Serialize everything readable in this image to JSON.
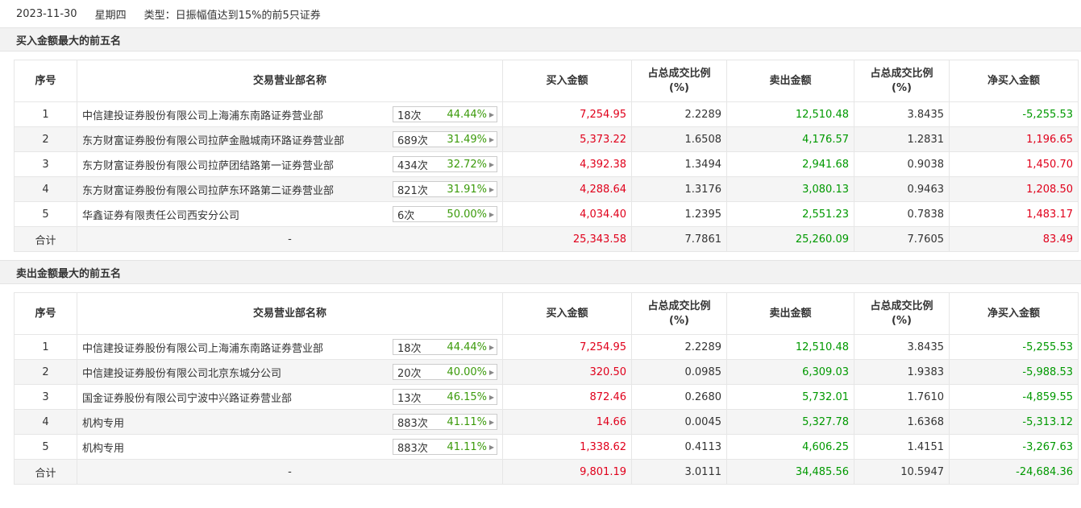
{
  "header": {
    "date": "2023-11-30",
    "weekday": "星期四",
    "type_text": "类型：日振幅值达到15%的前5只证券"
  },
  "columns": {
    "no": "序号",
    "dept": "交易营业部名称",
    "buy": "买入金额",
    "buy_ratio_l1": "占总成交比例",
    "buy_ratio_l2": "(%)",
    "sell": "卖出金额",
    "sell_ratio_l1": "占总成交比例",
    "sell_ratio_l2": "(%)",
    "net": "净买入金额"
  },
  "buy_section": {
    "title": "买入金额最大的前五名",
    "rows": [
      {
        "no": "1",
        "dept": "中信建投证券股份有限公司上海浦东南路证券营业部",
        "count": "18次",
        "pct": "44.44%",
        "buy": "7,254.95",
        "buy_ratio": "2.2289",
        "sell": "12,510.48",
        "sell_ratio": "3.8435",
        "net": "-5,255.53",
        "net_color": "green"
      },
      {
        "no": "2",
        "dept": "东方财富证券股份有限公司拉萨金融城南环路证券营业部",
        "count": "689次",
        "pct": "31.49%",
        "buy": "5,373.22",
        "buy_ratio": "1.6508",
        "sell": "4,176.57",
        "sell_ratio": "1.2831",
        "net": "1,196.65",
        "net_color": "red"
      },
      {
        "no": "3",
        "dept": "东方财富证券股份有限公司拉萨团结路第一证券营业部",
        "count": "434次",
        "pct": "32.72%",
        "buy": "4,392.38",
        "buy_ratio": "1.3494",
        "sell": "2,941.68",
        "sell_ratio": "0.9038",
        "net": "1,450.70",
        "net_color": "red"
      },
      {
        "no": "4",
        "dept": "东方财富证券股份有限公司拉萨东环路第二证券营业部",
        "count": "821次",
        "pct": "31.91%",
        "buy": "4,288.64",
        "buy_ratio": "1.3176",
        "sell": "3,080.13",
        "sell_ratio": "0.9463",
        "net": "1,208.50",
        "net_color": "red"
      },
      {
        "no": "5",
        "dept": "华鑫证券有限责任公司西安分公司",
        "count": "6次",
        "pct": "50.00%",
        "buy": "4,034.40",
        "buy_ratio": "1.2395",
        "sell": "2,551.23",
        "sell_ratio": "0.7838",
        "net": "1,483.17",
        "net_color": "red"
      }
    ],
    "total": {
      "label": "合计",
      "dept": "-",
      "buy": "25,343.58",
      "buy_ratio": "7.7861",
      "sell": "25,260.09",
      "sell_ratio": "7.7605",
      "net": "83.49"
    }
  },
  "sell_section": {
    "title": "卖出金额最大的前五名",
    "rows": [
      {
        "no": "1",
        "dept": "中信建投证券股份有限公司上海浦东南路证券营业部",
        "count": "18次",
        "pct": "44.44%",
        "buy": "7,254.95",
        "buy_ratio": "2.2289",
        "sell": "12,510.48",
        "sell_ratio": "3.8435",
        "net": "-5,255.53",
        "net_color": "green"
      },
      {
        "no": "2",
        "dept": "中信建投证券股份有限公司北京东城分公司",
        "count": "20次",
        "pct": "40.00%",
        "buy": "320.50",
        "buy_ratio": "0.0985",
        "sell": "6,309.03",
        "sell_ratio": "1.9383",
        "net": "-5,988.53",
        "net_color": "green"
      },
      {
        "no": "3",
        "dept": "国金证券股份有限公司宁波中兴路证券营业部",
        "count": "13次",
        "pct": "46.15%",
        "buy": "872.46",
        "buy_ratio": "0.2680",
        "sell": "5,732.01",
        "sell_ratio": "1.7610",
        "net": "-4,859.55",
        "net_color": "green"
      },
      {
        "no": "4",
        "dept": "机构专用",
        "count": "883次",
        "pct": "41.11%",
        "buy": "14.66",
        "buy_ratio": "0.0045",
        "sell": "5,327.78",
        "sell_ratio": "1.6368",
        "net": "-5,313.12",
        "net_color": "green"
      },
      {
        "no": "5",
        "dept": "机构专用",
        "count": "883次",
        "pct": "41.11%",
        "buy": "1,338.62",
        "buy_ratio": "0.4113",
        "sell": "4,606.25",
        "sell_ratio": "1.4151",
        "net": "-3,267.63",
        "net_color": "green"
      }
    ],
    "total": {
      "label": "合计",
      "dept": "-",
      "buy": "9,801.19",
      "buy_ratio": "3.0111",
      "sell": "34,485.56",
      "sell_ratio": "10.5947",
      "net": "-24,684.36"
    }
  },
  "colors": {
    "positive": "#e0001b",
    "negative": "#009900",
    "pct_green": "#3b9a0a"
  },
  "icons": {
    "badge_arrow": "caret-right-icon"
  }
}
